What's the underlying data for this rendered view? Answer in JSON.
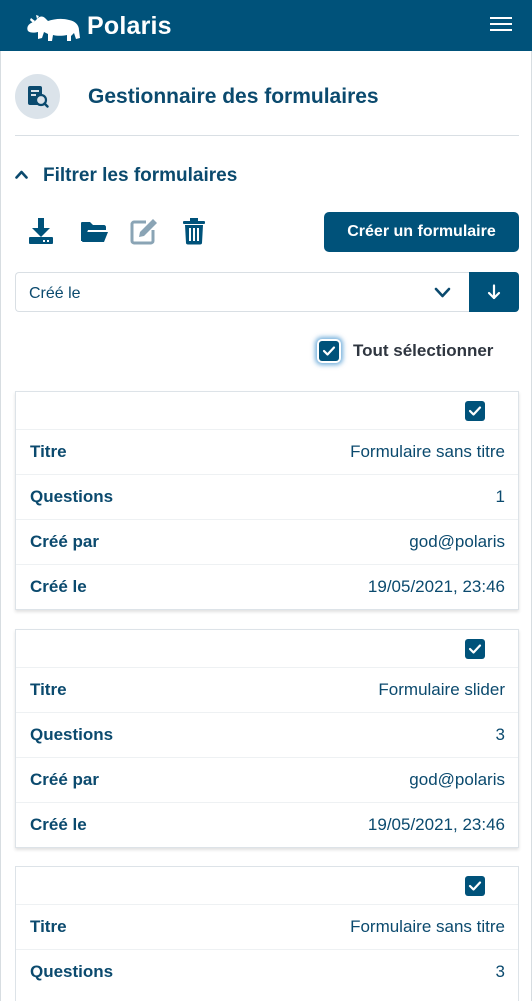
{
  "app": {
    "brand": "Polaris"
  },
  "page": {
    "title": "Gestionnaire des formulaires"
  },
  "filter": {
    "label": "Filtrer les formulaires",
    "expanded": true
  },
  "toolbar": {
    "tools": [
      "download-icon",
      "folder-open-icon",
      "edit-icon",
      "trash-icon"
    ],
    "create_label": "Créer un formulaire"
  },
  "sort": {
    "selected": "Créé le",
    "direction": "descending"
  },
  "select_all": {
    "label": "Tout sélectionner",
    "checked": true
  },
  "labels": {
    "title": "Titre",
    "questions": "Questions",
    "created_by": "Créé par",
    "created_at": "Créé le"
  },
  "forms": [
    {
      "checked": true,
      "title": "Formulaire sans titre",
      "questions": "1",
      "created_by": "god@polaris",
      "created_at": "19/05/2021, 23:46"
    },
    {
      "checked": true,
      "title": "Formulaire slider",
      "questions": "3",
      "created_by": "god@polaris",
      "created_at": "19/05/2021, 23:46"
    },
    {
      "checked": true,
      "title": "Formulaire sans titre",
      "questions": "3"
    }
  ],
  "colors": {
    "primary": "#00527a",
    "text": "#0b4a6e",
    "icon_bg": "#dbe3ea",
    "muted_icon": "#8aa4b5"
  }
}
